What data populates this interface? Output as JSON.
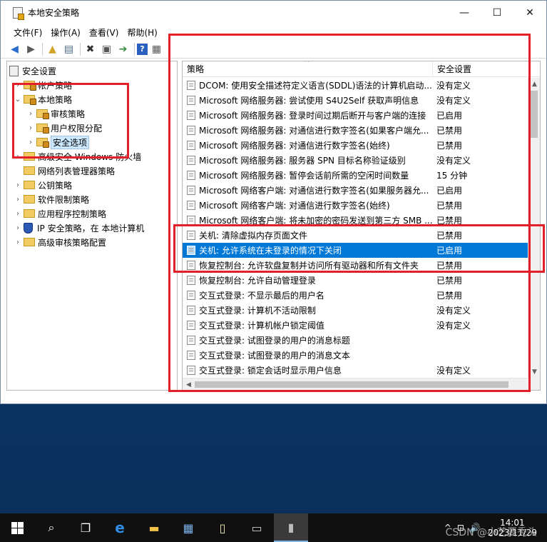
{
  "window": {
    "title": "本地安全策略",
    "controls": {
      "minimize": "—",
      "maximize": "☐",
      "close": "✕"
    }
  },
  "menu": [
    "文件(F)",
    "操作(A)",
    "查看(V)",
    "帮助(H)"
  ],
  "toolbar_icons": [
    "back-arrow-icon",
    "forward-arrow-icon",
    "up-folder-icon",
    "show-tree-icon",
    "delete-icon",
    "properties-icon",
    "export-icon",
    "help-icon",
    "view-icon"
  ],
  "tree": {
    "root": "安全设置",
    "items": [
      {
        "label": "帐户策略",
        "level": 1,
        "expander": "›"
      },
      {
        "label": "本地策略",
        "level": 1,
        "expander": "⌄"
      },
      {
        "label": "审核策略",
        "level": 2,
        "expander": "›"
      },
      {
        "label": "用户权限分配",
        "level": 2,
        "expander": "›"
      },
      {
        "label": "安全选项",
        "level": 2,
        "expander": "›",
        "selected": true
      },
      {
        "label": "高级安全 Windows 防火墙",
        "level": 1,
        "expander": "›"
      },
      {
        "label": "网络列表管理器策略",
        "level": 1,
        "expander": ""
      },
      {
        "label": "公钥策略",
        "level": 1,
        "expander": "›"
      },
      {
        "label": "软件限制策略",
        "level": 1,
        "expander": "›"
      },
      {
        "label": "应用程序控制策略",
        "level": 1,
        "expander": "›"
      },
      {
        "label": "IP 安全策略，在 本地计算机",
        "level": 1,
        "expander": "›",
        "icon": "shield"
      },
      {
        "label": "高级审核策略配置",
        "level": 1,
        "expander": "›"
      }
    ]
  },
  "list": {
    "columns": {
      "policy": "策略",
      "setting": "安全设置"
    },
    "rows": [
      {
        "policy": "DCOM: 使用安全描述符定义语言(SDDL)语法的计算机启动...",
        "setting": "没有定义"
      },
      {
        "policy": "Microsoft 网络服务器: 尝试使用 S4U2Self 获取声明信息",
        "setting": "没有定义"
      },
      {
        "policy": "Microsoft 网络服务器: 登录时间过期后断开与客户端的连接",
        "setting": "已启用"
      },
      {
        "policy": "Microsoft 网络服务器: 对通信进行数字签名(如果客户端允...",
        "setting": "已禁用"
      },
      {
        "policy": "Microsoft 网络服务器: 对通信进行数字签名(始终)",
        "setting": "已禁用"
      },
      {
        "policy": "Microsoft 网络服务器: 服务器 SPN 目标名称验证级别",
        "setting": "没有定义"
      },
      {
        "policy": "Microsoft 网络服务器: 暂停会话前所需的空闲时间数量",
        "setting": "15 分钟"
      },
      {
        "policy": "Microsoft 网络客户端: 对通信进行数字签名(如果服务器允...",
        "setting": "已启用"
      },
      {
        "policy": "Microsoft 网络客户端: 对通信进行数字签名(始终)",
        "setting": "已禁用"
      },
      {
        "policy": "Microsoft 网络客户端: 将未加密的密码发送到第三方 SMB ...",
        "setting": "已禁用"
      },
      {
        "policy": "关机: 清除虚拟内存页面文件",
        "setting": "已禁用"
      },
      {
        "policy": "关机: 允许系统在未登录的情况下关闭",
        "setting": "已启用",
        "selected": true
      },
      {
        "policy": "恢复控制台: 允许软盘复制并访问所有驱动器和所有文件夹",
        "setting": "已禁用"
      },
      {
        "policy": "恢复控制台: 允许自动管理登录",
        "setting": "已禁用"
      },
      {
        "policy": "交互式登录: 不显示最后的用户名",
        "setting": "已禁用"
      },
      {
        "policy": "交互式登录: 计算机不活动限制",
        "setting": "没有定义"
      },
      {
        "policy": "交互式登录: 计算机帐户锁定阈值",
        "setting": "没有定义"
      },
      {
        "policy": "交互式登录: 试图登录的用户的消息标题",
        "setting": ""
      },
      {
        "policy": "交互式登录: 试图登录的用户的消息文本",
        "setting": ""
      },
      {
        "policy": "交互式登录: 锁定会话时显示用户信息",
        "setting": "没有定义"
      }
    ]
  },
  "taskbar": {
    "apps": [
      "start-icon",
      "search-icon",
      "task-view-icon",
      "ie-icon",
      "file-explorer-icon",
      "server-manager-icon",
      "notepad-icon",
      "cmd-icon",
      "local-security-policy-icon"
    ],
    "time": "14:01",
    "date": "2023/11/29",
    "tray": [
      "^",
      "⊡",
      "🔊"
    ]
  },
  "watermark": "CSDN @小艺要秃头"
}
